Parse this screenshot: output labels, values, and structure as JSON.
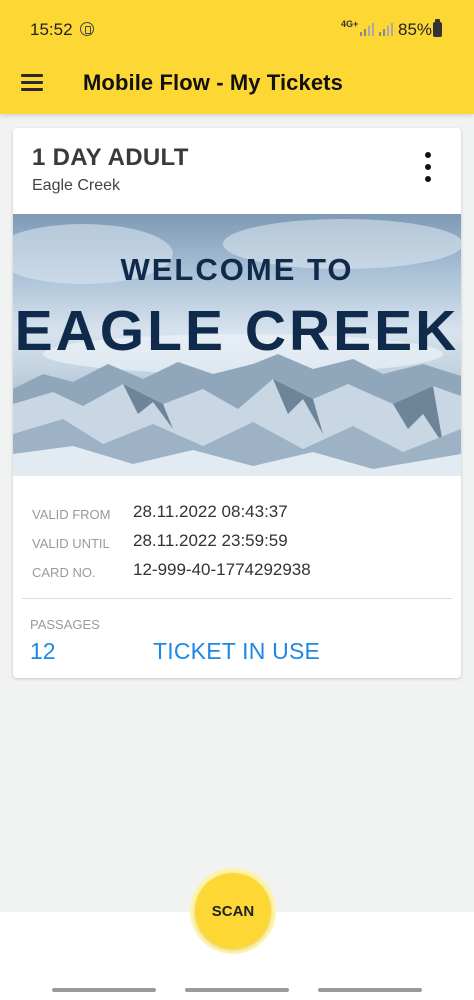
{
  "status_bar": {
    "time": "15:52",
    "network": "4G+",
    "battery": "85%"
  },
  "app_bar": {
    "title": "Mobile Flow - My Tickets"
  },
  "ticket": {
    "name": "1 DAY ADULT",
    "resort": "Eagle Creek",
    "banner": {
      "line1": "WELCOME TO",
      "line2": "EAGLE CREEK"
    },
    "details": [
      {
        "label": "VALID FROM",
        "value": "28.11.2022  08:43:37"
      },
      {
        "label": "VALID UNTIL",
        "value": "28.11.2022  23:59:59"
      },
      {
        "label": "CARD NO.",
        "value": "12-999-40-1774292938"
      }
    ],
    "passages_label": "PASSAGES",
    "passages_value": "12",
    "status": "TICKET IN USE"
  },
  "scan_button": {
    "label": "SCAN"
  },
  "colors": {
    "primary": "#fdd835",
    "link": "#1e88e5",
    "banner_text": "#0f2a4b"
  }
}
